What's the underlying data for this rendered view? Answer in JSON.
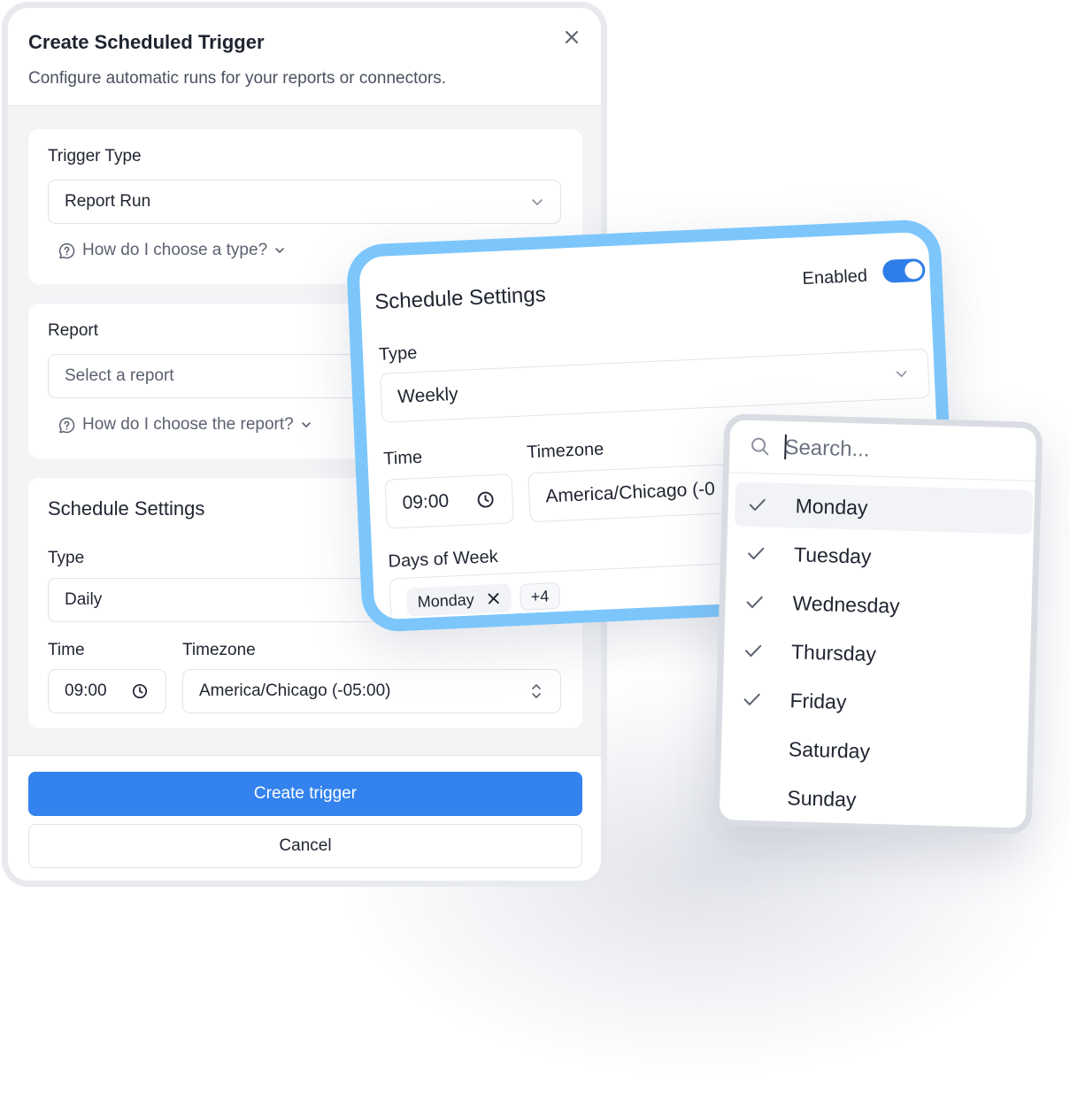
{
  "dialog": {
    "title": "Create Scheduled Trigger",
    "subtitle": "Configure automatic runs for your reports or connectors.",
    "trigger_type": {
      "label": "Trigger Type",
      "value": "Report Run",
      "help": "How do I choose a type?"
    },
    "report": {
      "label": "Report",
      "placeholder": "Select a report",
      "help": "How do I choose the report?"
    },
    "schedule": {
      "title": "Schedule Settings",
      "type_label": "Type",
      "type_value": "Daily",
      "time_label": "Time",
      "time_value": "09:00",
      "timezone_label": "Timezone",
      "timezone_value": "America/Chicago (-05:00)"
    },
    "create_label": "Create trigger",
    "cancel_label": "Cancel"
  },
  "schedule_card": {
    "title": "Schedule Settings",
    "enabled_label": "Enabled",
    "enabled": true,
    "type_label": "Type",
    "type_value": "Weekly",
    "time_label": "Time",
    "time_value": "09:00",
    "timezone_label": "Timezone",
    "timezone_value": "America/Chicago (-0",
    "days_label": "Days of Week",
    "chip_value": "Monday",
    "more_count": "+4"
  },
  "days_dropdown": {
    "search_placeholder": "Search...",
    "items": [
      {
        "label": "Monday",
        "checked": true
      },
      {
        "label": "Tuesday",
        "checked": true
      },
      {
        "label": "Wednesday",
        "checked": true
      },
      {
        "label": "Thursday",
        "checked": true
      },
      {
        "label": "Friday",
        "checked": true
      },
      {
        "label": "Saturday",
        "checked": false
      },
      {
        "label": "Sunday",
        "checked": false
      }
    ]
  },
  "colors": {
    "primary": "#3382ee",
    "card_border": "#7cc6fb",
    "toggle_on": "#2f7de9"
  }
}
